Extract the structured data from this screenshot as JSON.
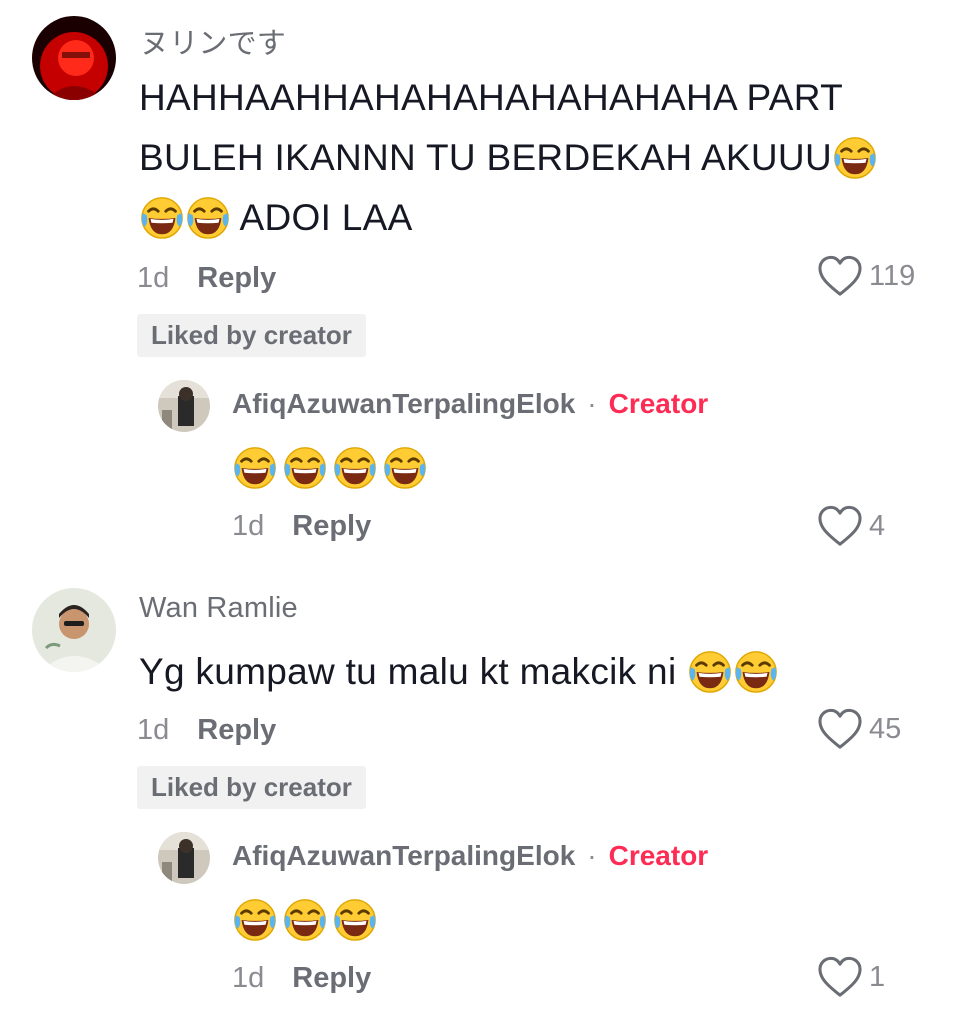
{
  "comments": [
    {
      "username": "ヌリンです",
      "text_line1": "HAHHAAHHAHAHAHAHAHAHAHA PART",
      "text_line2": "BULEH IKANNN TU BERDEKAH AKUUU",
      "text_line3": "ADOI LAA",
      "time": "1d",
      "reply_label": "Reply",
      "likes": "119",
      "liked_badge": "Liked by creator",
      "reply": {
        "username": "AfiqAzuwanTerpalingElok",
        "separator": "·",
        "creator_label": "Creator",
        "emoji_count": 4,
        "time": "1d",
        "reply_label": "Reply",
        "likes": "4"
      }
    },
    {
      "username": "Wan Ramlie",
      "text": "Yg kumpaw tu malu kt makcik ni",
      "time": "1d",
      "reply_label": "Reply",
      "likes": "45",
      "liked_badge": "Liked by creator",
      "reply": {
        "username": "AfiqAzuwanTerpalingElok",
        "separator": "·",
        "creator_label": "Creator",
        "emoji_count": 3,
        "time": "1d",
        "reply_label": "Reply",
        "likes": "1"
      }
    }
  ],
  "icons": {
    "like": "heart-outline-icon",
    "emoji": "face-with-tears-of-joy-emoji"
  },
  "colors": {
    "creator_accent": "#fe2c55",
    "muted_text": "#8a8b91",
    "badge_bg": "#f1f1f2"
  }
}
